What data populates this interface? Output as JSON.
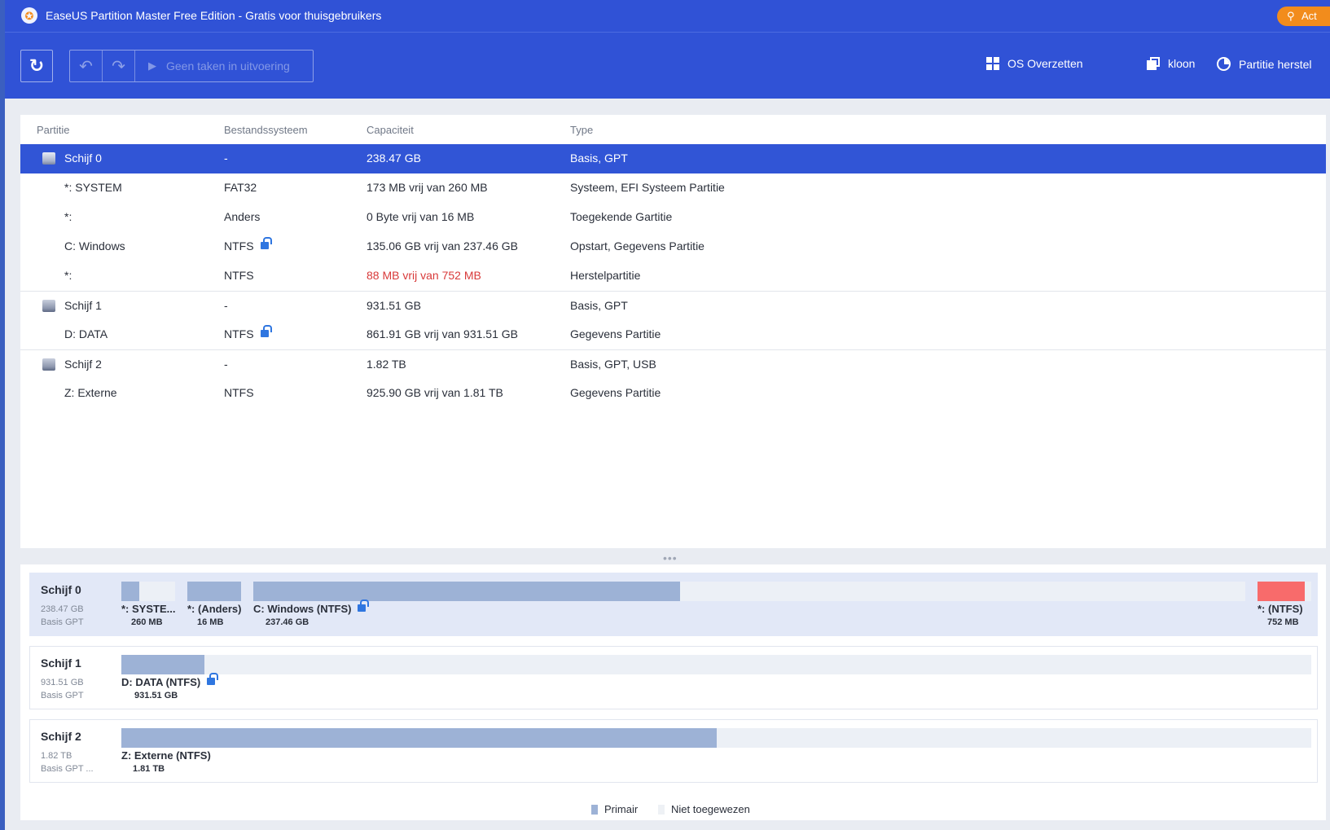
{
  "window": {
    "title": "EaseUS Partition Master Free Edition - Gratis voor thuisgebruikers",
    "activate_label": "Act"
  },
  "toolbar": {
    "refresh_icon": "refresh-icon",
    "pending_label": "Geen taken in uitvoering",
    "os_migrate_label": "OS Overzetten",
    "clone_label": "kloon",
    "recovery_label": "Partitie herstel"
  },
  "table": {
    "headers": {
      "partition": "Partitie",
      "filesystem": "Bestandssysteem",
      "capacity": "Capaciteit",
      "type": "Type"
    },
    "rows": [
      {
        "name": "Schijf 0",
        "fs": "-",
        "capacity": "238.47 GB",
        "type": "Basis, GPT"
      },
      {
        "name": "*: SYSTEM",
        "fs": "FAT32",
        "capacity": "173 MB vrij van 260 MB",
        "type": "Systeem, EFI Systeem Partitie"
      },
      {
        "name": "*:",
        "fs": "Anders",
        "capacity": "0 Byte vrij van 16 MB",
        "type": "Toegekende Gartitie"
      },
      {
        "name": "C: Windows",
        "fs": "NTFS",
        "capacity": "135.06 GB vrij van 237.46 GB",
        "type": "Opstart, Gegevens Partitie"
      },
      {
        "name": "*:",
        "fs": "NTFS",
        "capacity": "88 MB vrij van 752 MB",
        "type": "Herstelpartitie"
      },
      {
        "name": "Schijf 1",
        "fs": "-",
        "capacity": "931.51 GB",
        "type": "Basis, GPT"
      },
      {
        "name": "D: DATA",
        "fs": "NTFS",
        "capacity": "861.91 GB vrij van 931.51 GB",
        "type": "Gegevens Partitie"
      },
      {
        "name": "Schijf 2",
        "fs": "-",
        "capacity": "1.82 TB",
        "type": "Basis, GPT, USB"
      },
      {
        "name": "Z: Externe",
        "fs": "NTFS",
        "capacity": "925.90 GB vrij van 1.81 TB",
        "type": "Gegevens Partitie"
      }
    ]
  },
  "disk_map": {
    "disks": [
      {
        "name": "Schijf 0",
        "size": "238.47 GB",
        "type": "Basis GPT",
        "partitions": [
          {
            "label": "*: SYSTE...",
            "size": "260 MB",
            "used_fraction": 0.33
          },
          {
            "label": "*: (Anders)",
            "size": "16 MB",
            "used_fraction": 1.0
          },
          {
            "label": "C: Windows (NTFS)",
            "size": "237.46 GB",
            "used_fraction": 0.43
          },
          {
            "label": "*: (NTFS)",
            "size": "752 MB",
            "used_fraction": 1.0
          }
        ]
      },
      {
        "name": "Schijf 1",
        "size": "931.51 GB",
        "type": "Basis GPT",
        "partitions": [
          {
            "label": "D: DATA (NTFS)",
            "size": "931.51 GB",
            "used_fraction": 0.07
          }
        ]
      },
      {
        "name": "Schijf 2",
        "size": "1.82 TB",
        "type": "Basis GPT ...",
        "partitions": [
          {
            "label": "Z: Externe (NTFS)",
            "size": "1.81 TB",
            "used_fraction": 0.5
          }
        ]
      }
    ]
  },
  "legend": {
    "primary": "Primair",
    "unallocated": "Niet toegewezen"
  },
  "colors": {
    "header_blue": "#3052d6",
    "selection_blue": "#3155d6",
    "partition_fill": "#9db2d6",
    "recovery_partition": "#f86b6b",
    "low_space_text": "#d83a3a",
    "activate_orange": "#f28c1c"
  },
  "icons": {
    "lock": "unlocked-lock-icon",
    "disk": "disk-icon",
    "splitter": "more-dots-icon"
  }
}
